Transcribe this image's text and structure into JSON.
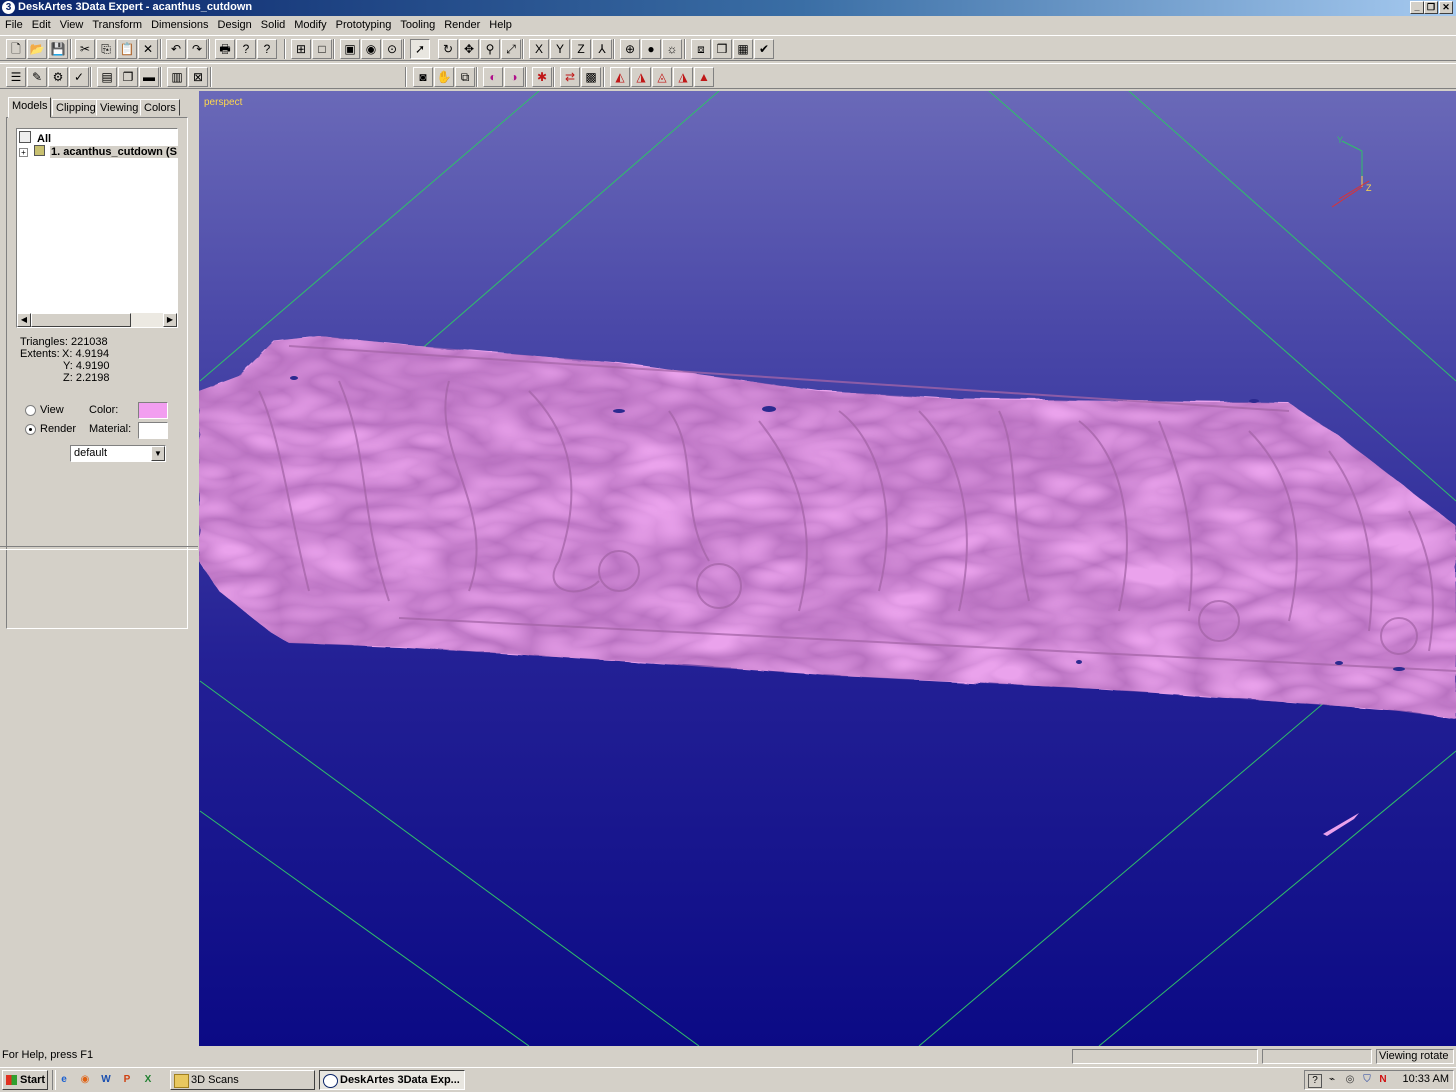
{
  "window": {
    "title": "DeskArtes 3Data Expert - acanthus_cutdown",
    "app_icon": "3"
  },
  "menu": [
    "File",
    "Edit",
    "View",
    "Transform",
    "Dimensions",
    "Design",
    "Solid",
    "Modify",
    "Prototyping",
    "Tooling",
    "Render",
    "Help"
  ],
  "caption_buttons": {
    "minimize": "_",
    "restore": "❐",
    "close": "✕"
  },
  "toolbar1": [
    {
      "name": "new-file-icon",
      "glyph": "🗋"
    },
    {
      "name": "open-folder-icon",
      "glyph": "📂"
    },
    {
      "name": "save-icon",
      "glyph": "💾"
    },
    {
      "name": "cut-icon",
      "glyph": "✂"
    },
    {
      "name": "copy-icon",
      "glyph": "⎘"
    },
    {
      "name": "paste-icon",
      "glyph": "📋"
    },
    {
      "name": "delete-icon",
      "glyph": "✕"
    },
    {
      "name": "undo-icon",
      "glyph": "↶"
    },
    {
      "name": "redo-icon",
      "glyph": "↷"
    },
    {
      "name": "print-icon",
      "glyph": "🖶"
    },
    {
      "name": "help-icon",
      "glyph": "?"
    },
    {
      "name": "context-help-icon",
      "glyph": "?"
    },
    {
      "name": "multi-view-icon",
      "glyph": "⊞"
    },
    {
      "name": "single-view-icon",
      "glyph": "□"
    },
    {
      "name": "zoom-box-icon",
      "glyph": "▣"
    },
    {
      "name": "zoom-in-icon",
      "glyph": "◉"
    },
    {
      "name": "zoom-fit-icon",
      "glyph": "⊙"
    },
    {
      "name": "select-arrow-icon",
      "glyph": "➚"
    },
    {
      "name": "rotate-icon",
      "glyph": "↻"
    },
    {
      "name": "pan-icon",
      "glyph": "✥"
    },
    {
      "name": "zoom-icon",
      "glyph": "⚲"
    },
    {
      "name": "zoom-dynamic-icon",
      "glyph": "⤢"
    },
    {
      "name": "view-x-icon",
      "glyph": "X"
    },
    {
      "name": "view-y-icon",
      "glyph": "Y"
    },
    {
      "name": "view-z-icon",
      "glyph": "Z"
    },
    {
      "name": "view-axes-icon",
      "glyph": "⅄"
    },
    {
      "name": "globe-icon",
      "glyph": "⊕"
    },
    {
      "name": "shading-icon",
      "glyph": "●"
    },
    {
      "name": "lighting-icon",
      "glyph": "☼"
    },
    {
      "name": "cube-icon",
      "glyph": "⧈"
    },
    {
      "name": "box-icon",
      "glyph": "❒"
    },
    {
      "name": "grid-icon",
      "glyph": "▦"
    },
    {
      "name": "check-icon",
      "glyph": "✔"
    }
  ],
  "toolbar2_left": [
    {
      "name": "model-list-icon",
      "glyph": "☰"
    },
    {
      "name": "model-edit-icon",
      "glyph": "✎"
    },
    {
      "name": "model-props-icon",
      "glyph": "⚙"
    },
    {
      "name": "model-check-icon",
      "glyph": "✓"
    },
    {
      "name": "doc-icon",
      "glyph": "▤"
    },
    {
      "name": "layers-icon",
      "glyph": "❐"
    },
    {
      "name": "folder-icon",
      "glyph": "▬"
    },
    {
      "name": "panel-toggle-icon",
      "glyph": "▥"
    },
    {
      "name": "panel-close-icon",
      "glyph": "⊠"
    }
  ],
  "toolbar2_center": [
    {
      "name": "camera-icon",
      "glyph": "◙"
    },
    {
      "name": "hand-icon",
      "glyph": "✋"
    },
    {
      "name": "copy-mesh-icon",
      "glyph": "⧉"
    },
    {
      "name": "paint-icon",
      "glyph": "◐"
    },
    {
      "name": "color-fill-icon",
      "glyph": "◑"
    },
    {
      "name": "repair-icon",
      "glyph": "✱"
    },
    {
      "name": "fix-icon",
      "glyph": "⇄"
    },
    {
      "name": "triangulate-icon",
      "glyph": "▩"
    },
    {
      "name": "triangle-flag-icon",
      "glyph": "◭"
    },
    {
      "name": "triangle-select-icon",
      "glyph": "◮"
    },
    {
      "name": "triangle-cursor-icon",
      "glyph": "◬"
    },
    {
      "name": "triangle-edge-icon",
      "glyph": "◮"
    },
    {
      "name": "triangle-red-icon",
      "glyph": "▲"
    }
  ],
  "left_panel": {
    "tabs": [
      "Models",
      "Clipping",
      "Viewing",
      "Colors"
    ],
    "tree": {
      "root": "All",
      "item": "1. acanthus_cutdown (S"
    },
    "triangles_label": "Triangles:",
    "triangles": "221038",
    "extents_label": "Extents:",
    "x_label": "X:",
    "x": "4.9194",
    "y_label": "Y:",
    "y": "4.9190",
    "z_label": "Z:",
    "z": "2.2198",
    "view_label": "View",
    "render_label": "Render",
    "render_selected": true,
    "color_label": "Color:",
    "color_value": "#f29ef0",
    "material_label": "Material:",
    "material_value": "#ffffff",
    "material_select": "default"
  },
  "viewport": {
    "label": "perspect",
    "axis_y": "Y",
    "axis_z": "Z",
    "model_color": "#eaa2ec",
    "grid_color": "#2fbf6a"
  },
  "status": {
    "help": "For Help, press F1",
    "mode": "Viewing rotate"
  },
  "taskbar": {
    "start": "Start",
    "quicklaunch": [
      {
        "name": "ie-icon",
        "glyph": "e"
      },
      {
        "name": "firefox-icon",
        "glyph": "◉"
      },
      {
        "name": "word-icon",
        "glyph": "W"
      },
      {
        "name": "powerpoint-icon",
        "glyph": "P"
      },
      {
        "name": "excel-icon",
        "glyph": "X"
      }
    ],
    "tasks": [
      {
        "label": "3D Scans"
      },
      {
        "label": "DeskArtes 3Data Exp..."
      }
    ],
    "clock": "10:33 AM"
  }
}
